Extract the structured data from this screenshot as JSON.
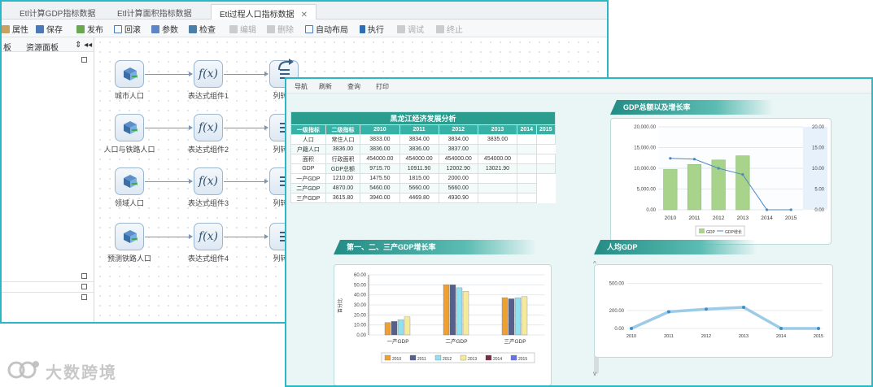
{
  "back_window": {
    "tabs": [
      {
        "label": "Etl计算GDP指标数据"
      },
      {
        "label": "Etl计算面积指标数据"
      },
      {
        "label": "Etl过程人口指标数据",
        "close": "✕"
      }
    ],
    "toolbar": [
      {
        "label": "属性",
        "disabled": false
      },
      {
        "label": "保存",
        "disabled": false
      },
      {
        "label": "发布",
        "disabled": false
      },
      {
        "label": "回滚",
        "disabled": false
      },
      {
        "label": "参数",
        "disabled": false
      },
      {
        "label": "检查",
        "disabled": false
      },
      {
        "label": "编辑",
        "disabled": true
      },
      {
        "label": "删除",
        "disabled": true
      },
      {
        "label": "自动布局",
        "disabled": false
      },
      {
        "label": "执行",
        "disabled": false
      },
      {
        "label": "调试",
        "disabled": true
      },
      {
        "label": "终止",
        "disabled": true
      }
    ],
    "left_panel": {
      "tabs": [
        "板",
        "资源面板"
      ],
      "pin": "⇕ ◂◂"
    },
    "flow_rows": [
      {
        "source": "城市人口",
        "expr": "表达式组件1",
        "out": "列转行"
      },
      {
        "source": "人口与铁路人口",
        "expr": "表达式组件2",
        "out": "列转行"
      },
      {
        "source": "领域人口",
        "expr": "表达式组件3",
        "out": "列转行"
      },
      {
        "source": "预测铁路人口",
        "expr": "表达式组件4",
        "out": "列转行"
      }
    ],
    "fx_label": "f(x)"
  },
  "report": {
    "toolbar": [
      "导航",
      "刷新",
      "查询",
      "打印"
    ],
    "table": {
      "title": "黑龙江经济发展分析",
      "headers": [
        "一级指标",
        "二级指标",
        "2010",
        "2011",
        "2012",
        "2013",
        "2014",
        "2015"
      ],
      "groups": [
        {
          "name": "人口",
          "rows": [
            [
              "常住人口",
              "3833.00",
              "3834.00",
              "3834.00",
              "3835.00",
              "",
              ""
            ],
            [
              "户籍人口",
              "3836.00",
              "3836.00",
              "3836.00",
              "3837.00",
              "",
              ""
            ]
          ]
        },
        {
          "name": "面积",
          "rows": [
            [
              "行政面积",
              "454000.00",
              "454000.00",
              "454000.00",
              "454000.00",
              "",
              ""
            ]
          ]
        },
        {
          "name": "GDP",
          "rows": [
            [
              "GDP总额",
              "9715.70",
              "10911.90",
              "12002.90",
              "13021.90",
              "",
              ""
            ],
            [
              "一产GDP",
              "1210.00",
              "1475.50",
              "1815.00",
              "2000.00",
              "",
              ""
            ],
            [
              "二产GDP",
              "4870.00",
              "5460.00",
              "5660.00",
              "5660.00",
              "",
              ""
            ],
            [
              "三产GDP",
              "3615.80",
              "3940.00",
              "4469.80",
              "4930.90",
              "",
              ""
            ]
          ]
        }
      ]
    },
    "scroll_arrows": [
      "^",
      "v"
    ]
  },
  "watermark": "大数跨境",
  "colors": {
    "accent": "#2bb7c4",
    "teal": "#2a9d8f"
  },
  "chart_data": [
    {
      "type": "bar",
      "title": "GDP总额以及增长率",
      "categories": [
        "2010",
        "2011",
        "2012",
        "2013",
        "2014",
        "2015"
      ],
      "series": [
        {
          "name": "GDP",
          "kind": "bar",
          "values": [
            9715.7,
            10911.9,
            12002.9,
            13021.9,
            0,
            0
          ]
        },
        {
          "name": "GDP增长",
          "kind": "line",
          "axis": "right",
          "values": [
            12.4,
            12.2,
            10.0,
            8.5,
            0,
            0
          ]
        }
      ],
      "yticks_left": [
        "0.00",
        "5,000.00",
        "10,000.00",
        "15,000.00",
        "20,000.00"
      ],
      "yticks_right": [
        "0.00",
        "5.00",
        "10.00",
        "15.00",
        "20.00"
      ],
      "ylim": [
        0,
        20000
      ],
      "ylim_right": [
        0,
        20
      ],
      "legend": "bottom"
    },
    {
      "type": "bar",
      "title": "第一、二、三产GDP增长率",
      "categories": [
        "一产GDP",
        "二产GDP",
        "三产GDP"
      ],
      "ylabel": "百分比",
      "yticks": [
        "0.00",
        "10.00",
        "20.00",
        "30.00",
        "40.00",
        "50.00",
        "60.00"
      ],
      "ylim": [
        0,
        60
      ],
      "series": [
        {
          "name": "2010",
          "values": [
            12.4,
            50.1,
            37.2
          ]
        },
        {
          "name": "2011",
          "values": [
            13.5,
            50.0,
            36.1
          ]
        },
        {
          "name": "2012",
          "values": [
            15.1,
            47.1,
            37.0
          ]
        },
        {
          "name": "2013",
          "values": [
            18.0,
            43.5,
            38.2
          ]
        },
        {
          "name": "2014",
          "values": [
            0,
            0,
            0
          ]
        },
        {
          "name": "2015",
          "values": [
            0,
            0,
            0
          ]
        }
      ],
      "legend": "bottom"
    },
    {
      "type": "line",
      "title": "人均GDP",
      "categories": [
        "2010",
        "2011",
        "2012",
        "2013",
        "2014",
        "2015"
      ],
      "yticks": [
        "0.00",
        "200.00",
        "500.00"
      ],
      "ylim": [
        0,
        560
      ],
      "series": [
        {
          "name": "人均GDP",
          "values": [
            0,
            185,
            215,
            235,
            0,
            0
          ]
        }
      ]
    }
  ]
}
